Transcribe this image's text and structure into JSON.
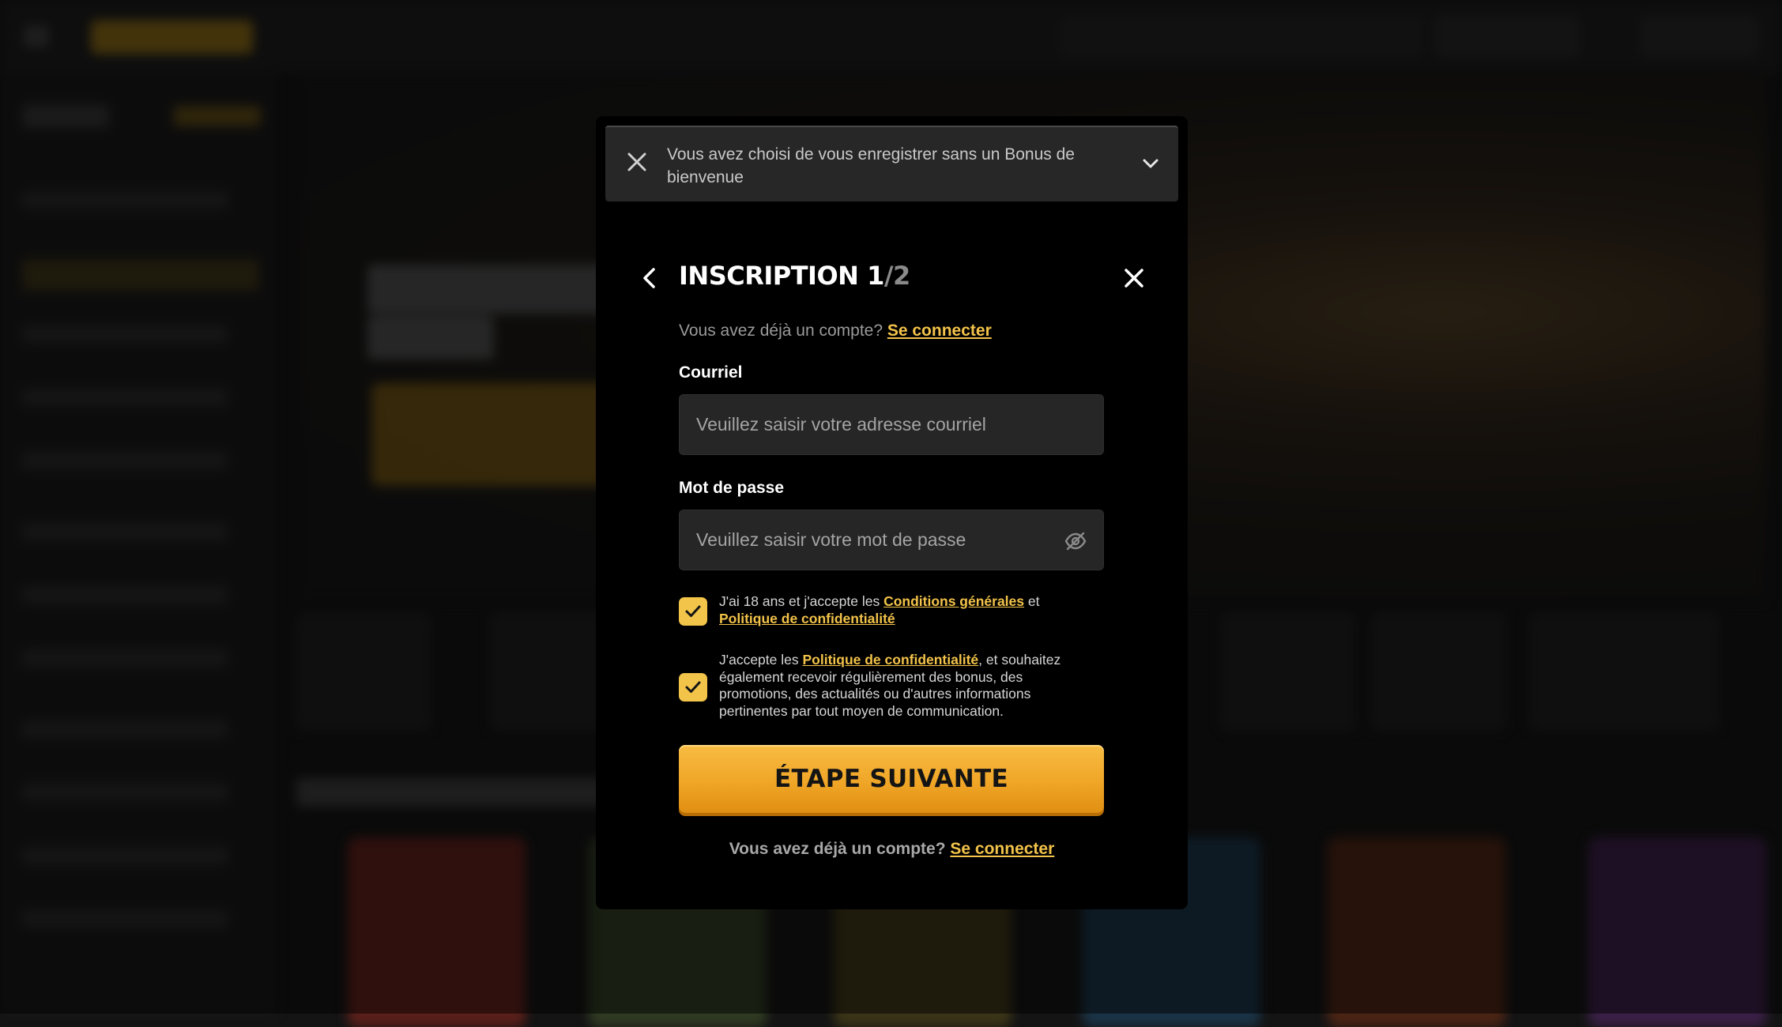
{
  "notice": {
    "text": "Vous avez choisi de vous enregistrer sans un Bonus de bienvenue"
  },
  "header": {
    "title": "INSCRIPTION 1",
    "step_suffix": "/2"
  },
  "already_account": {
    "text": "Vous avez déjà un compte?",
    "link": "Se connecter"
  },
  "email": {
    "label": "Courriel",
    "placeholder": "Veuillez saisir votre adresse courriel",
    "value": ""
  },
  "password": {
    "label": "Mot de passe",
    "placeholder": "Veuillez saisir votre mot de passe",
    "value": ""
  },
  "consents": [
    {
      "checked": true,
      "prefix": "J'ai 18 ans et j'accepte les ",
      "link1": "Conditions générales",
      "middle": " et ",
      "link2": "Politique de confidentialité"
    },
    {
      "checked": true,
      "prefix": "J'accepte les ",
      "link1": "Politique de confidentialité",
      "suffix": ", et souhaitez également recevoir régulièrement des bonus, des promotions, des actualités ou d'autres informations pertinentes par tout moyen de communication."
    }
  ],
  "submit": {
    "label": "ÉTAPE SUIVANTE"
  },
  "bottom_already": {
    "text": "Vous avez déjà un compte?",
    "link": "Se connecter"
  },
  "colors": {
    "accent": "#f2c44a",
    "button": "#f0a627",
    "modal_bg": "#000000",
    "input_bg": "#262626"
  },
  "icons": [
    "close-icon",
    "chevron-down-icon",
    "back-arrow-icon",
    "eye-off-icon",
    "check-icon"
  ]
}
